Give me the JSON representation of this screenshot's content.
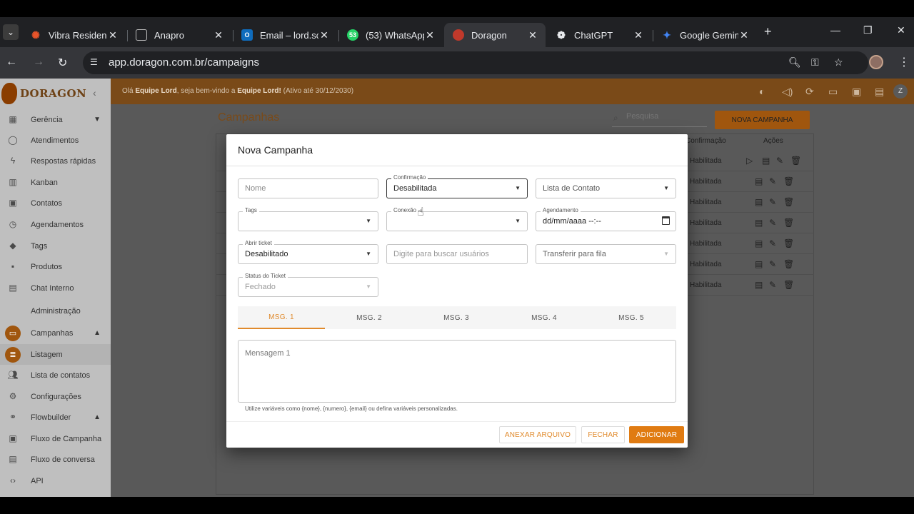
{
  "browser": {
    "tabs": [
      {
        "title": "Vibra Residencial",
        "favicon": "vibra-icon",
        "color": "#e8542a"
      },
      {
        "title": "Anapro",
        "favicon": "anapro-icon",
        "color": "#5f6368"
      },
      {
        "title": "Email – lord.sc",
        "favicon": "outlook-icon",
        "color": "#0f6cbd"
      },
      {
        "title": "(53) WhatsApp",
        "favicon": "whatsapp-icon",
        "color": "#25d366"
      },
      {
        "title": "Doragon",
        "favicon": "doragon-icon",
        "color": "#c0392b"
      },
      {
        "title": "ChatGPT",
        "favicon": "chatgpt-icon",
        "color": "#e8eaed"
      },
      {
        "title": "Google Gemini",
        "favicon": "gemini-icon",
        "color": "#4285f4"
      }
    ],
    "whatsapp_badge": "53",
    "url": "app.doragon.com.br/campaigns"
  },
  "sidebar": {
    "logo": "DORAGON",
    "items": [
      {
        "label": "Gerência",
        "icon": "dashboard-icon"
      },
      {
        "label": "Atendimentos",
        "icon": "whatsapp-icon"
      },
      {
        "label": "Respostas rápidas",
        "icon": "bolt-icon"
      },
      {
        "label": "Kanban",
        "icon": "kanban-icon"
      },
      {
        "label": "Contatos",
        "icon": "contacts-icon"
      },
      {
        "label": "Agendamentos",
        "icon": "clock-icon"
      },
      {
        "label": "Tags",
        "icon": "tag-icon"
      },
      {
        "label": "Produtos",
        "icon": "product-icon"
      },
      {
        "label": "Chat Interno",
        "icon": "chat-icon"
      }
    ],
    "admin_label": "Administração",
    "campanhas": "Campanhas",
    "sub_items": [
      {
        "label": "Listagem",
        "icon": "list-icon"
      },
      {
        "label": "Lista de contatos",
        "icon": "people-icon"
      },
      {
        "label": "Configurações",
        "icon": "gear-icon"
      }
    ],
    "flowbuilder": "Flowbuilder",
    "flow_items": [
      {
        "label": "Fluxo de Campanha",
        "icon": "event-icon"
      },
      {
        "label": "Fluxo de conversa",
        "icon": "forum-icon"
      }
    ],
    "api": "API"
  },
  "banner": {
    "prefix": "Olá ",
    "user": "Equipe Lord",
    "middle": ", seja bem-vindo a ",
    "company": "Equipe Lord!",
    "suffix": " (Ativo até 30/12/2030)",
    "avatar": "Z"
  },
  "page": {
    "title": "Campanhas",
    "search_placeholder": "Pesquisa",
    "new_button": "NOVA CAMPANHA",
    "col_confirmacao": "Confirmação",
    "col_acoes": "Ações",
    "row_status": "Habilitada",
    "row_count_visible": 7
  },
  "modal": {
    "title": "Nova Campanha",
    "nome_placeholder": "Nome",
    "confirmacao_label": "Confirmação",
    "confirmacao_value": "Desabilitada",
    "lista_placeholder": "Lista de Contato",
    "tags_label": "Tags",
    "conexao_label": "Conexão",
    "agendamento_label": "Agendamento",
    "agendamento_value": "dd/mm/aaaa --:--",
    "abrir_label": "Abrir ticket",
    "abrir_value": "Desabilitado",
    "buscar_placeholder": "Digite para buscar usuários",
    "fila_placeholder": "Transferir para fila",
    "status_label": "Status do Ticket",
    "status_value": "Fechado",
    "msg_tabs": [
      "MSG. 1",
      "MSG. 2",
      "MSG. 3",
      "MSG. 4",
      "MSG. 5"
    ],
    "active_tab": 0,
    "mensagem_placeholder": "Mensagem 1",
    "hint": "Utilize variáveis como {nome}, {numero}, {email} ou defina variáveis personalizadas.",
    "btn_anexar": "ANEXAR ARQUIVO",
    "btn_fechar": "FECHAR",
    "btn_adicionar": "ADICIONAR"
  },
  "colors": {
    "accent": "#e07b12",
    "banner": "#7a4a18"
  }
}
